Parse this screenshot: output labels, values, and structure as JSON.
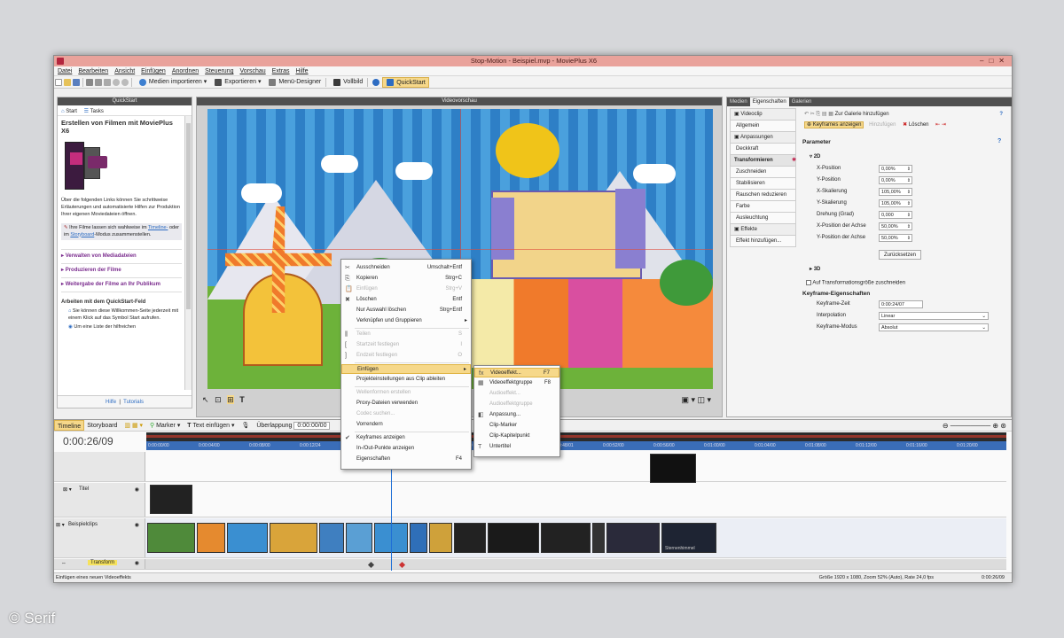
{
  "window": {
    "title": "Stop-Motion - Beispiel.mvp - MoviePlus X6",
    "controls": [
      "–",
      "□",
      "✕"
    ]
  },
  "menu": [
    "Datei",
    "Bearbeiten",
    "Ansicht",
    "Einfügen",
    "Anordnen",
    "Steuerung",
    "Vorschau",
    "Extras",
    "Hilfe"
  ],
  "toolbar": {
    "import": "Medien importieren",
    "export": "Exportieren",
    "menu_designer": "Menü-Designer",
    "fullscreen": "Vollbild",
    "quickstart": "QuickStart"
  },
  "quickstart_panel": {
    "header": "QuickStart",
    "tab_start": "Start",
    "tab_tasks": "Tasks",
    "title": "Erstellen von Filmen mit MoviePlus X6",
    "intro": "Über die folgenden Links können Sie schrittweise Erläuterungen und automatisierte Hilfen zur Produktion Ihrer eigenen Moviedateien öffnen.",
    "tip_prefix": "Ihre Filme lassen sich wahlweise im",
    "tip_link1": "Timeline-",
    "tip_mid": "oder im",
    "tip_link2": "Storyboard",
    "tip_suffix": "-Modus zusammenstellen.",
    "links": [
      "Verwalten von Mediadateien",
      "Produzieren der Filme",
      "Weitergabe der Filme an Ihr Publikum"
    ],
    "section2_title": "Arbeiten mit dem QuickStart-Feld",
    "bullet1": "Sie können diese Willkommen-Seite jederzeit mit einem Klick auf das Symbol Start aufrufen.",
    "bullet2": "Um eine Liste der hilfreichen",
    "footer_help": "Hilfe",
    "footer_tutorials": "Tutorials"
  },
  "preview": {
    "header": "Videovorschau"
  },
  "props_panel": {
    "tabs": [
      "Medien",
      "Eigenschaften",
      "Galerien"
    ],
    "list": [
      {
        "label": "Videoclip",
        "kind": "grp"
      },
      {
        "label": "Allgemein",
        "kind": "sub"
      },
      {
        "label": "Anpassungen",
        "kind": "grp"
      },
      {
        "label": "Deckkraft",
        "kind": "sub"
      },
      {
        "label": "Transformieren",
        "kind": "sel"
      },
      {
        "label": "Zuschneiden",
        "kind": "sub"
      },
      {
        "label": "Stabilisieren",
        "kind": "sub"
      },
      {
        "label": "Rauschen reduzieren",
        "kind": "sub"
      },
      {
        "label": "Farbe",
        "kind": "sub"
      },
      {
        "label": "Ausleuchtung",
        "kind": "sub"
      },
      {
        "label": "Effekte",
        "kind": "grp"
      },
      {
        "label": "Effekt hinzufügen...",
        "kind": "sub"
      }
    ],
    "add_gallery": "Zur Galerie hinzufügen",
    "keyframes_btn": "Keyframes anzeigen",
    "add_btn": "Hinzufügen",
    "delete_btn": "Löschen",
    "params_title": "Parameter",
    "group_2d": "2D",
    "rows": [
      {
        "label": "X-Position",
        "value": "0,00%"
      },
      {
        "label": "Y-Position",
        "value": "0,00%"
      },
      {
        "label": "X-Skalierung",
        "value": "105,00%"
      },
      {
        "label": "Y-Skalierung",
        "value": "105,00%"
      },
      {
        "label": "Drehung (Grad)",
        "value": "0,000"
      },
      {
        "label": "X-Position der Achse",
        "value": "50,00%"
      },
      {
        "label": "Y-Position der Achse",
        "value": "50,00%"
      }
    ],
    "reset_btn": "Zurücksetzen",
    "group_3d": "3D",
    "crop_checkbox": "Auf Transformationsgröße zuschneiden",
    "kf_title": "Keyframe-Eigenschaften",
    "kf_time_label": "Keyframe-Zeit",
    "kf_time_value": "0:00:24/07",
    "interp_label": "Interpolation",
    "interp_value": "Linear",
    "mode_label": "Keyframe-Modus",
    "mode_value": "Absolut"
  },
  "timeline": {
    "tab_timeline": "Timeline",
    "tab_storyboard": "Storyboard",
    "marker": "Marker",
    "insert_text": "Text einfügen",
    "overlap_label": "Überlappung",
    "overlap_value": "0:00:00/00",
    "timecode": "0:00:26/09",
    "ruler_ticks": [
      "0:00:00/00",
      "0:00:04/00",
      "0:00:08/00",
      "0:00:12/24",
      "0:00:16/00",
      "0:00:20/00",
      "0:00:40/00",
      "0:00:44/00",
      "0:00:48/01",
      "0:00:52/00",
      "0:00:56/00",
      "0:01:00/00",
      "0:01:04/00",
      "0:01:08/00",
      "0:01:12/00",
      "0:01:16/00",
      "0:01:20/00"
    ],
    "track_titel": "Titel",
    "track_clips": "Beispielclips",
    "track_transform": "Transform",
    "clip_label": "Sternenhimmel"
  },
  "status": {
    "left": "Einfügen eines neuen Videoeffekts",
    "right": "Größe 1920 x 1080, Zoom 52% (Auto), Rate 24,0 fps",
    "time": "0:00:26/09"
  },
  "context_menu": [
    {
      "label": "Ausschneiden",
      "sc": "Umschalt+Entf",
      "ic": "✂"
    },
    {
      "label": "Kopieren",
      "sc": "Strg+C",
      "ic": "⎘"
    },
    {
      "label": "Einfügen",
      "sc": "Strg+V",
      "dis": true,
      "ic": "📋"
    },
    {
      "label": "Löschen",
      "sc": "Entf",
      "ic": "✖"
    },
    {
      "label": "Nur Auswahl löschen",
      "sc": "Strg+Entf"
    },
    {
      "label": "Verknüpfen und Gruppieren",
      "arrow": true
    },
    {
      "sep": true
    },
    {
      "label": "Teilen",
      "sc": "S",
      "dis": true,
      "ic": "⫼"
    },
    {
      "label": "Startzeit festlegen",
      "sc": "I",
      "dis": true,
      "ic": "["
    },
    {
      "label": "Endzeit festlegen",
      "sc": "O",
      "dis": true,
      "ic": "]"
    },
    {
      "sep": true
    },
    {
      "label": "Einfügen",
      "arrow": true,
      "hl": true
    },
    {
      "label": "Projekteinstellungen aus Clip ableiten"
    },
    {
      "sep": true
    },
    {
      "label": "Wellenformen erstellen",
      "dis": true
    },
    {
      "label": "Proxy-Dateien verwenden"
    },
    {
      "label": "Codec suchen...",
      "dis": true
    },
    {
      "label": "Vorrendern"
    },
    {
      "sep": true
    },
    {
      "label": "Keyframes anzeigen",
      "ic": "✔"
    },
    {
      "label": "In-/Out-Punkte anzeigen"
    },
    {
      "label": "Eigenschaften",
      "sc": "F4"
    }
  ],
  "submenu": [
    {
      "label": "Videoeffekt...",
      "sc": "F7",
      "hl": true,
      "ic": "fx"
    },
    {
      "label": "Videoeffektgruppe",
      "sc": "F8",
      "ic": "▦"
    },
    {
      "label": "Audioeffekt...",
      "dis": true
    },
    {
      "label": "Audioeffektgruppe",
      "dis": true
    },
    {
      "label": "Anpassung...",
      "ic": "◧"
    },
    {
      "label": "Clip-Marker"
    },
    {
      "label": "Clip-Kapitelpunkt"
    },
    {
      "label": "Untertitel",
      "ic": "T"
    }
  ],
  "copyright": "© Serif",
  "colors": {
    "title_bar": "#e9a29b",
    "timeline_ruler": "#3a6db8",
    "menu_highlight": "#f6d88a",
    "sky": "#3a8fd1"
  }
}
